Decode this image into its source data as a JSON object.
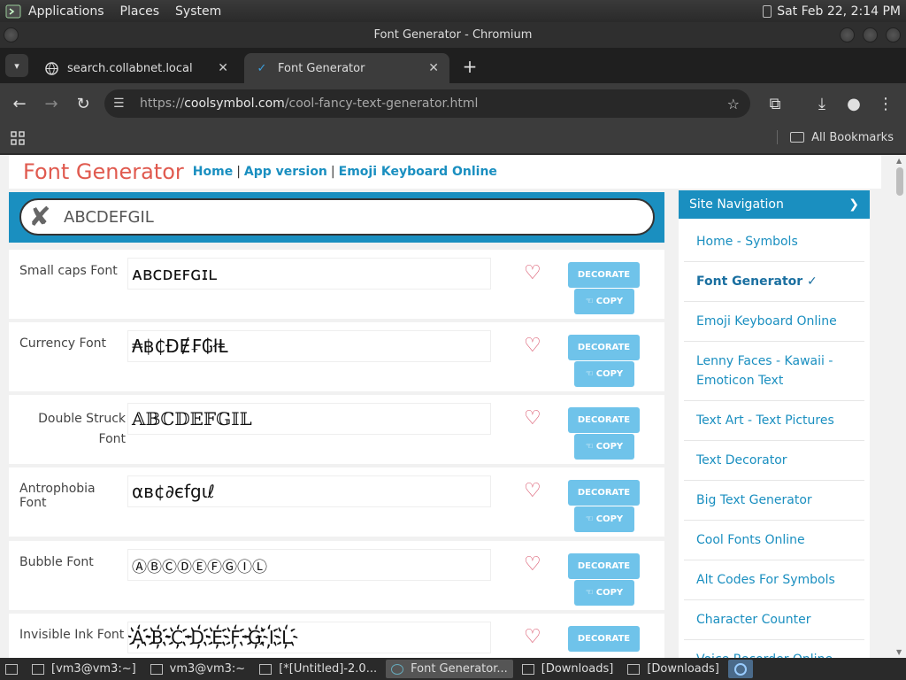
{
  "top_panel": {
    "menus": [
      "Applications",
      "Places",
      "System"
    ],
    "clock": "Sat Feb 22,  2:14 PM"
  },
  "window": {
    "title": "Font Generator - Chromium"
  },
  "tabs": [
    {
      "title": "search.collabnet.local",
      "active": false
    },
    {
      "title": "Font Generator",
      "active": true
    }
  ],
  "omnibox": {
    "scheme": "https://",
    "host": "coolsymbol.com",
    "path": "/cool-fancy-text-generator.html"
  },
  "bookmarks": {
    "all_label": "All Bookmarks"
  },
  "site": {
    "logo": "Font Generator",
    "header_links": [
      "Home",
      "App version",
      "Emoji Keyboard Online"
    ],
    "input_value": "ABCDEFGIL"
  },
  "font_rows": [
    {
      "label": "Small caps Font",
      "preview": "ᴀʙᴄᴅᴇꜰɢɪʟ"
    },
    {
      "label": "Currency Font",
      "preview": "₳฿₵ĐɆ₣₲łⱠ"
    },
    {
      "label": "Double Struck Font",
      "preview": "𝔸𝔹ℂ𝔻𝔼𝔽𝔾𝕀𝕃"
    },
    {
      "label": "Antrophobia Font",
      "preview": "αв¢∂єfgιℓ"
    },
    {
      "label": "Bubble Font",
      "preview": "ⒶⒷⒸⒹⒺⒻⒼⒾⓁ"
    },
    {
      "label": "Invisible Ink Font",
      "preview": "A҉B҉C҉D҉E҉F҉G҉I҉L҉"
    }
  ],
  "buttons": {
    "decorate": "DECORATE",
    "copy": "COPY"
  },
  "sidenav": {
    "title": "Site Navigation",
    "items": [
      "Home - Symbols",
      "Font Generator ✓",
      "Emoji Keyboard Online",
      "Lenny Faces - Kawaii - Emoticon Text",
      "Text Art - Text Pictures",
      "Text Decorator",
      "Big Text Generator",
      "Cool Fonts Online",
      "Alt Codes For Symbols",
      "Character Counter",
      "Voice Recorder Online"
    ]
  },
  "taskbar": [
    "[vm3@vm3:~]",
    "vm3@vm3:~",
    "[*[Untitled]-2.0...",
    "Font Generator...",
    "[Downloads]",
    "[Downloads]"
  ],
  "colors": {
    "accent": "#1a8fc0",
    "logo": "#e05a4f",
    "button": "#6fc3ea",
    "heart": "#d9536a"
  }
}
